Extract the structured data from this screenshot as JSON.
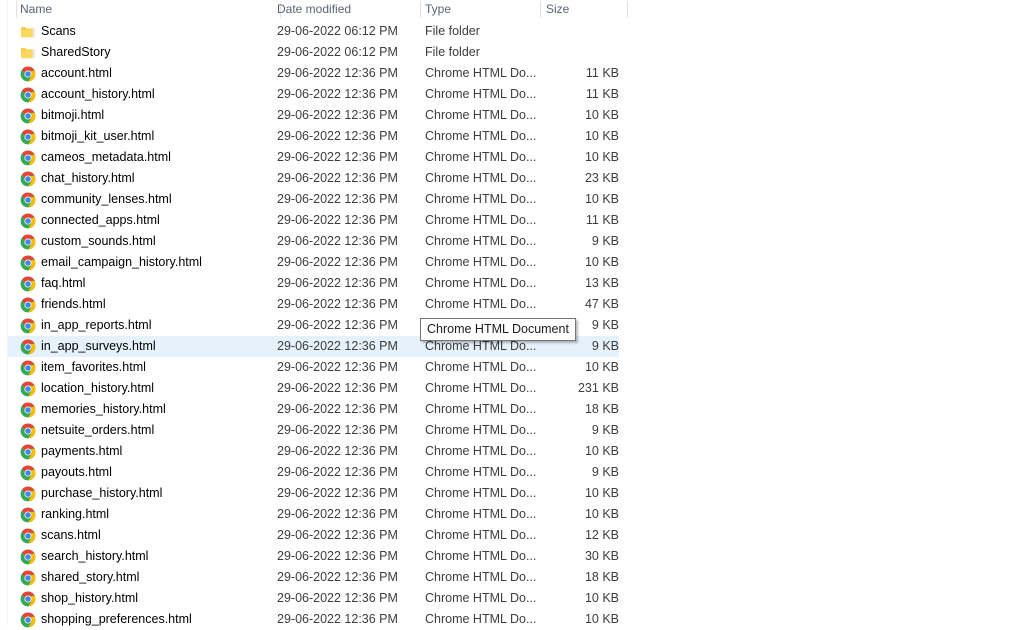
{
  "header": {
    "columns": [
      {
        "key": "name",
        "label": "Name"
      },
      {
        "key": "date",
        "label": "Date modified"
      },
      {
        "key": "type",
        "label": "Type"
      },
      {
        "key": "size",
        "label": "Size"
      }
    ]
  },
  "colors": {
    "selection": "#e5f1fb",
    "header_text": "#5a6472",
    "row_text": "#000000",
    "secondary_text": "#3d3d3d",
    "tooltip_border": "#767676",
    "tooltip_background": "#ffffff",
    "folder_icon": "#fbd860",
    "chrome_red": "#ea4335",
    "chrome_yellow": "#fbbc05",
    "chrome_green": "#34a853",
    "chrome_blue": "#4285f4"
  },
  "tooltip": {
    "text": "Chrome HTML Document",
    "visible": true
  },
  "selection": {
    "selected_index": 15,
    "selected_name": "in_app_reports.html"
  },
  "rows": [
    {
      "icon": "folder-icon",
      "name": "Scans",
      "date": "29-06-2022 06:12 PM",
      "type": "File folder",
      "size": ""
    },
    {
      "icon": "folder-icon",
      "name": "SharedStory",
      "date": "29-06-2022 06:12 PM",
      "type": "File folder",
      "size": ""
    },
    {
      "icon": "chrome-icon",
      "name": "account.html",
      "date": "29-06-2022 12:36 PM",
      "type": "Chrome HTML Do...",
      "size": "11 KB"
    },
    {
      "icon": "chrome-icon",
      "name": "account_history.html",
      "date": "29-06-2022 12:36 PM",
      "type": "Chrome HTML Do...",
      "size": "11 KB"
    },
    {
      "icon": "chrome-icon",
      "name": "bitmoji.html",
      "date": "29-06-2022 12:36 PM",
      "type": "Chrome HTML Do...",
      "size": "10 KB"
    },
    {
      "icon": "chrome-icon",
      "name": "bitmoji_kit_user.html",
      "date": "29-06-2022 12:36 PM",
      "type": "Chrome HTML Do...",
      "size": "10 KB"
    },
    {
      "icon": "chrome-icon",
      "name": "cameos_metadata.html",
      "date": "29-06-2022 12:36 PM",
      "type": "Chrome HTML Do...",
      "size": "10 KB"
    },
    {
      "icon": "chrome-icon",
      "name": "chat_history.html",
      "date": "29-06-2022 12:36 PM",
      "type": "Chrome HTML Do...",
      "size": "23 KB"
    },
    {
      "icon": "chrome-icon",
      "name": "community_lenses.html",
      "date": "29-06-2022 12:36 PM",
      "type": "Chrome HTML Do...",
      "size": "10 KB"
    },
    {
      "icon": "chrome-icon",
      "name": "connected_apps.html",
      "date": "29-06-2022 12:36 PM",
      "type": "Chrome HTML Do...",
      "size": "11 KB"
    },
    {
      "icon": "chrome-icon",
      "name": "custom_sounds.html",
      "date": "29-06-2022 12:36 PM",
      "type": "Chrome HTML Do...",
      "size": "9 KB"
    },
    {
      "icon": "chrome-icon",
      "name": "email_campaign_history.html",
      "date": "29-06-2022 12:36 PM",
      "type": "Chrome HTML Do...",
      "size": "10 KB"
    },
    {
      "icon": "chrome-icon",
      "name": "faq.html",
      "date": "29-06-2022 12:36 PM",
      "type": "Chrome HTML Do...",
      "size": "13 KB"
    },
    {
      "icon": "chrome-icon",
      "name": "friends.html",
      "date": "29-06-2022 12:36 PM",
      "type": "Chrome HTML Do...",
      "size": "47 KB"
    },
    {
      "icon": "chrome-icon",
      "name": "in_app_reports.html",
      "date": "29-06-2022 12:36 PM",
      "type": "Chrome HTML Do...",
      "size": "9 KB"
    },
    {
      "icon": "chrome-icon",
      "name": "in_app_surveys.html",
      "date": "29-06-2022 12:36 PM",
      "type": "Chrome HTML Do...",
      "size": "9 KB"
    },
    {
      "icon": "chrome-icon",
      "name": "item_favorites.html",
      "date": "29-06-2022 12:36 PM",
      "type": "Chrome HTML Do...",
      "size": "10 KB"
    },
    {
      "icon": "chrome-icon",
      "name": "location_history.html",
      "date": "29-06-2022 12:36 PM",
      "type": "Chrome HTML Do...",
      "size": "231 KB"
    },
    {
      "icon": "chrome-icon",
      "name": "memories_history.html",
      "date": "29-06-2022 12:36 PM",
      "type": "Chrome HTML Do...",
      "size": "18 KB"
    },
    {
      "icon": "chrome-icon",
      "name": "netsuite_orders.html",
      "date": "29-06-2022 12:36 PM",
      "type": "Chrome HTML Do...",
      "size": "9 KB"
    },
    {
      "icon": "chrome-icon",
      "name": "payments.html",
      "date": "29-06-2022 12:36 PM",
      "type": "Chrome HTML Do...",
      "size": "10 KB"
    },
    {
      "icon": "chrome-icon",
      "name": "payouts.html",
      "date": "29-06-2022 12:36 PM",
      "type": "Chrome HTML Do...",
      "size": "9 KB"
    },
    {
      "icon": "chrome-icon",
      "name": "purchase_history.html",
      "date": "29-06-2022 12:36 PM",
      "type": "Chrome HTML Do...",
      "size": "10 KB"
    },
    {
      "icon": "chrome-icon",
      "name": "ranking.html",
      "date": "29-06-2022 12:36 PM",
      "type": "Chrome HTML Do...",
      "size": "10 KB"
    },
    {
      "icon": "chrome-icon",
      "name": "scans.html",
      "date": "29-06-2022 12:36 PM",
      "type": "Chrome HTML Do...",
      "size": "12 KB"
    },
    {
      "icon": "chrome-icon",
      "name": "search_history.html",
      "date": "29-06-2022 12:36 PM",
      "type": "Chrome HTML Do...",
      "size": "30 KB"
    },
    {
      "icon": "chrome-icon",
      "name": "shared_story.html",
      "date": "29-06-2022 12:36 PM",
      "type": "Chrome HTML Do...",
      "size": "18 KB"
    },
    {
      "icon": "chrome-icon",
      "name": "shop_history.html",
      "date": "29-06-2022 12:36 PM",
      "type": "Chrome HTML Do...",
      "size": "10 KB"
    },
    {
      "icon": "chrome-icon",
      "name": "shopping_preferences.html",
      "date": "29-06-2022 12:36 PM",
      "type": "Chrome HTML Do...",
      "size": "10 KB"
    }
  ]
}
